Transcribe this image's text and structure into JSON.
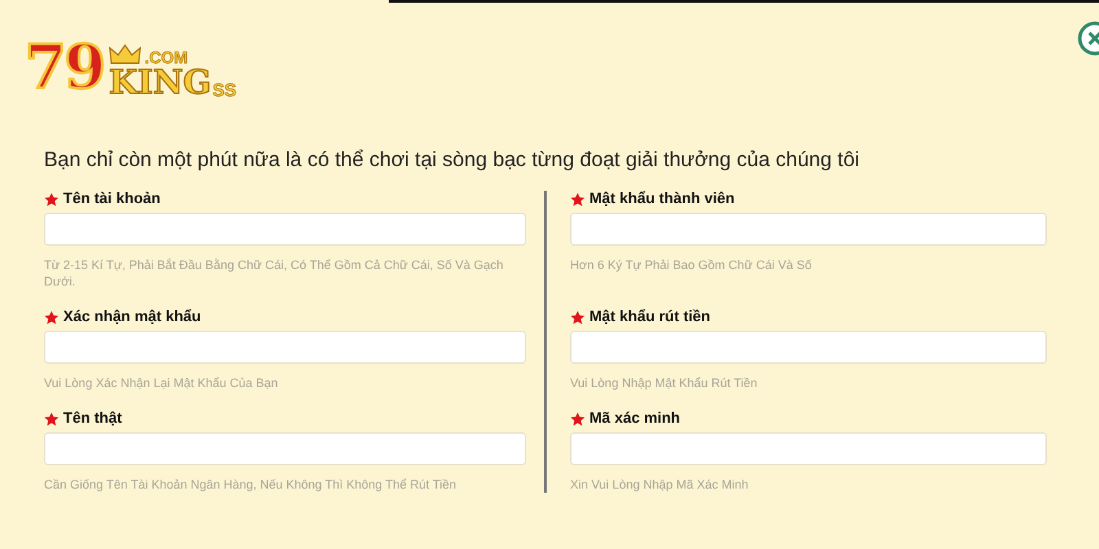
{
  "logo": {
    "number": "79",
    "domain": ".COM",
    "word": "KING",
    "suffix": "SS"
  },
  "intro": "Bạn chỉ còn một phút nữa là có thể chơi tại sòng bạc từng đoạt giải thưởng của chúng tôi",
  "left_column": {
    "fields": [
      {
        "label": "Tên tài khoản",
        "required": true,
        "hint": "Từ 2-15 Kí Tự, Phải Bắt Đầu Bằng Chữ Cái, Có Thể Gồm Cả Chữ Cái, Số Và Gạch Dưới."
      },
      {
        "label": "Xác nhận mật khẩu",
        "required": true,
        "hint": "Vui Lòng Xác Nhận Lại Mật Khẩu Của Bạn"
      },
      {
        "label": "Tên thật",
        "required": true,
        "hint": "Cần Giống Tên Tài Khoản Ngân Hàng, Nếu Không Thì Không Thể Rút Tiền"
      }
    ]
  },
  "right_column": {
    "fields": [
      {
        "label": "Mật khẩu thành viên",
        "required": true,
        "hint": "Hơn 6 Ký Tự Phải Bao Gồm Chữ Cái Và Số"
      },
      {
        "label": "Mật khẩu rút tiền",
        "required": true,
        "hint": "Vui Lòng Nhập Mật Khẩu Rút Tiền"
      },
      {
        "label": "Mã xác minh",
        "required": true,
        "hint": "Xin Vui Lòng Nhập Mã Xác Minh"
      }
    ]
  }
}
